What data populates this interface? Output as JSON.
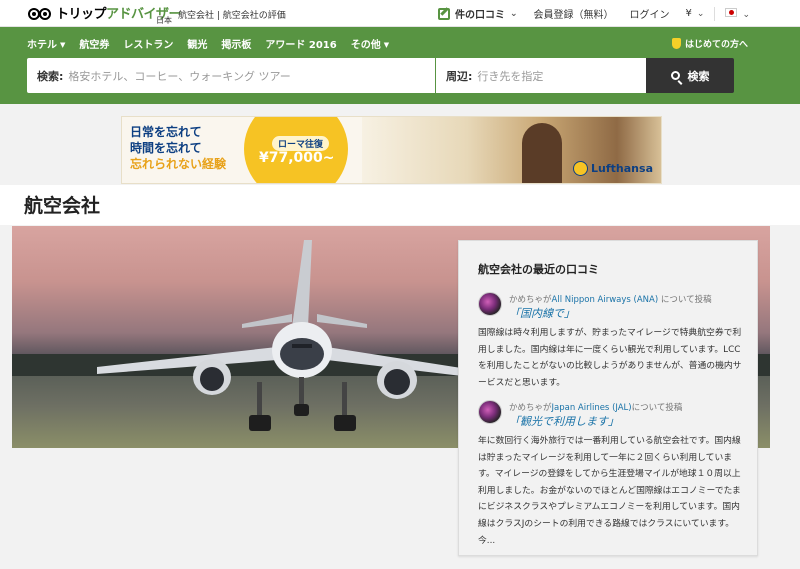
{
  "header": {
    "logo_black": "トリップ",
    "logo_green": "アドバイザー",
    "logo_sub": "日本",
    "breadcrumb": "航空会社 | 航空会社の評価",
    "write_review": "件の口コミ",
    "register": "会員登録（無料）",
    "login": "ログイン",
    "currency": "¥"
  },
  "nav": {
    "items": [
      {
        "label": "ホテル",
        "dropdown": true
      },
      {
        "label": "航空券",
        "dropdown": false
      },
      {
        "label": "レストラン",
        "dropdown": false
      },
      {
        "label": "観光",
        "dropdown": false
      },
      {
        "label": "掲示板",
        "dropdown": false
      },
      {
        "label": "アワード 2016",
        "dropdown": false
      },
      {
        "label": "その他",
        "dropdown": true
      }
    ],
    "first_time": "はじめての方へ"
  },
  "search": {
    "label": "検索:",
    "placeholder": "格安ホテル、コーヒー、ウォーキング ツアー",
    "near_label": "周辺:",
    "near_placeholder": "行き先を指定",
    "button": "検索"
  },
  "ad": {
    "line1": "日常を忘れて",
    "line2": "時間を忘れて",
    "line3": "忘れられない経験",
    "route": "ローマ往復",
    "price": "¥77,000~",
    "brand": "Lufthansa"
  },
  "page": {
    "title": "航空会社"
  },
  "reviews": {
    "title": "航空会社の最近の口コミ",
    "items": [
      {
        "user": "かめちゃが",
        "airline": "All Nippon Airways (ANA)",
        "suffix": "について投稿",
        "quote": "「国内線で」",
        "body": "国際線は時々利用しますが、貯まったマイレージで特典航空券で利用しました。国内線は年に一度くらい観光で利用しています。LCCを利用したことがないの比較しようがありませんが、普通の機内サービスだと思います。"
      },
      {
        "user": "かめちゃが",
        "airline": "Japan Airlines (JAL)",
        "suffix": "について投稿",
        "quote": "「観光で利用します」",
        "body": "年に数回行く海外旅行では一番利用している航空会社です。国内線は貯まったマイレージを利用して一年に２回くらい利用しています。マイレージの登録をしてから生涯登場マイルが地球１０周以上利用しました。お金がないのでほとんど国際線はエコノミーでたまにビジネスクラスやプレミアムエコノミーを利用しています。国内線はクラスJのシートの利用できる路線ではクラスにいています。今..."
      }
    ]
  },
  "colors": {
    "brand_green": "#589442",
    "link_blue": "#1a73a8",
    "dark_button": "#333333"
  }
}
